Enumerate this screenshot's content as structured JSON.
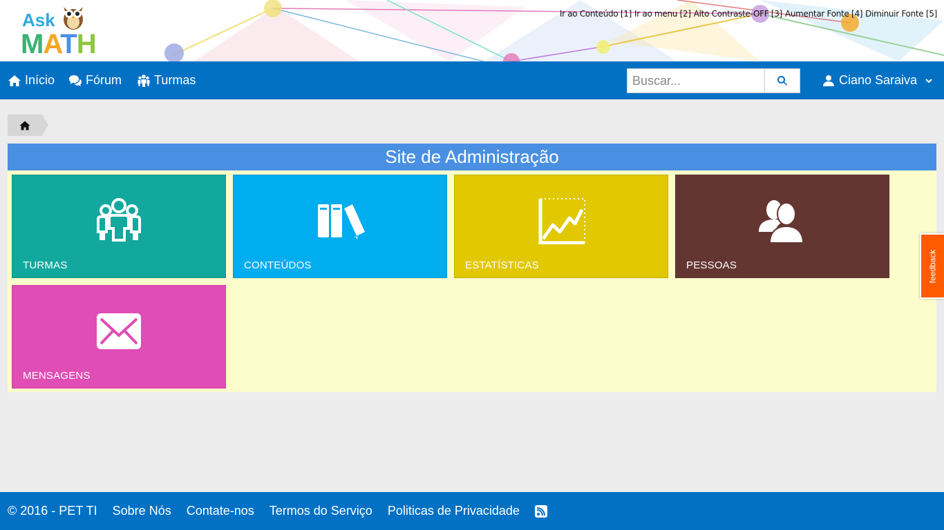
{
  "brand": {
    "logo_ask": "Ask",
    "logo_math": [
      "M",
      "A",
      "T",
      "H"
    ]
  },
  "accessibility": [
    "Ir ao Conteúdo [1]",
    "Ir ao menu [2]",
    "Alto Contraste-OFF [3]",
    "Aumentar Fonte [4]",
    "Diminuir Fonte [5]"
  ],
  "nav": {
    "items": [
      {
        "label": "Início",
        "icon": "home-icon"
      },
      {
        "label": "Fórum",
        "icon": "chat-bubbles-icon"
      },
      {
        "label": "Turmas",
        "icon": "group-icon"
      }
    ],
    "search_placeholder": "Buscar...",
    "user_name": "Ciano Saraiva"
  },
  "panel": {
    "title": "Site de Administração",
    "tiles": [
      {
        "label": "TURMAS",
        "color": "#13a89e",
        "icon": "group-icon"
      },
      {
        "label": "CONTEÚDOS",
        "color": "#00adee",
        "icon": "books-icon"
      },
      {
        "label": "ESTATÍSTICAS",
        "color": "#e1c800",
        "icon": "line-chart-icon"
      },
      {
        "label": "PESSOAS",
        "color": "#643632",
        "icon": "people-icon"
      },
      {
        "label": "MENSAGENS",
        "color": "#e04db5",
        "icon": "envelope-icon"
      }
    ]
  },
  "feedback_label": "feedback",
  "footer": {
    "copyright": "© 2016 - PET TI",
    "links": [
      "Sobre Nós",
      "Contate-nos",
      "Termos do Serviço",
      "Politicas de Privacidade"
    ],
    "rss_icon": "rss-icon"
  },
  "colors": {
    "navbar": "#0271c4",
    "panel_header": "#4a90e2",
    "panel_body": "#fdfdcb",
    "feedback": "#ff5a00"
  }
}
